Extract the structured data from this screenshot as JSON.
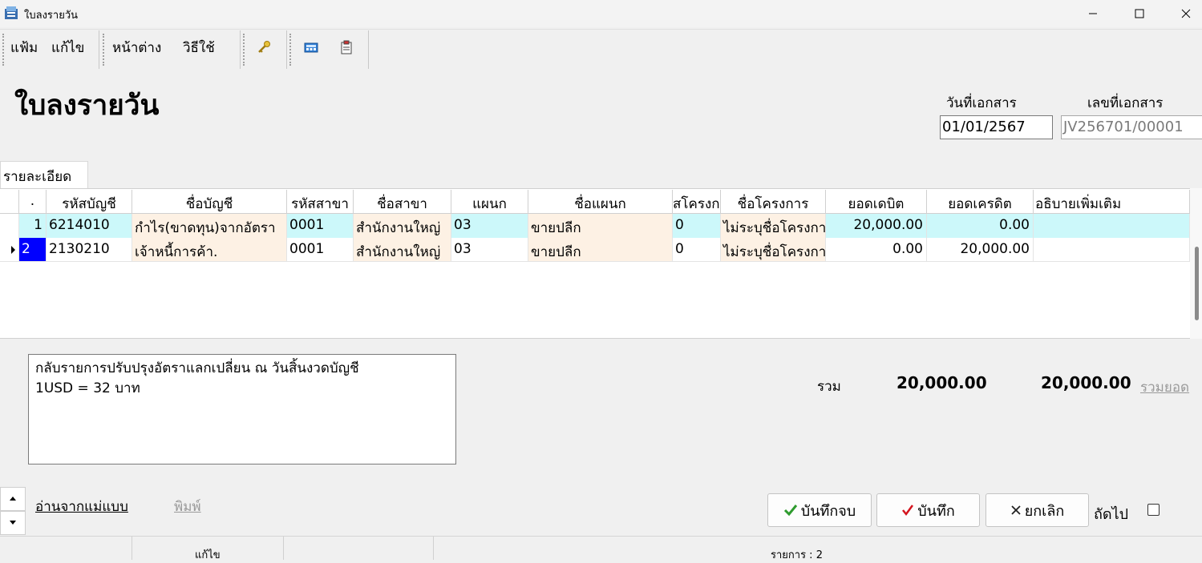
{
  "window": {
    "title": "ใบลงรายวัน"
  },
  "menu": {
    "file": "แฟ้ม",
    "edit": "แก้ไข",
    "window": "หน้าต่าง",
    "help": "วิธีใช้"
  },
  "page": {
    "title": "ใบลงรายวัน"
  },
  "doc": {
    "date_label": "วันที่เอกสาร",
    "date_value": "01/01/2567",
    "number_label": "เลขที่เอกสาร",
    "number_value": "JV256701/00001"
  },
  "tabs": {
    "detail": "รายละเอียด"
  },
  "grid": {
    "headers": {
      "seq": ".",
      "account_code": "รหัสบัญชี",
      "account_name": "ชื่อบัญชี",
      "branch_code": "รหัสสาขา",
      "branch_name": "ชื่อสาขา",
      "dept": "แผนก",
      "dept_name": "ชื่อแผนก",
      "project_code": "สโครงก",
      "project_name": "ชื่อโครงการ",
      "debit": "ยอดเดบิต",
      "credit": "ยอดเครดิต",
      "note": "อธิบายเพิ่มเติม"
    },
    "rows": [
      {
        "seq": "1",
        "account_code": "6214010",
        "account_name": "กำไร(ขาดทุน)จากอัตรา",
        "branch_code": "0001",
        "branch_name": "สำนักงานใหญ่",
        "dept": "03",
        "dept_name": "ขายปลีก",
        "project_code": "0",
        "project_name": "ไม่ระบุชื่อโครงการ",
        "debit": "20,000.00",
        "credit": "0.00",
        "note": ""
      },
      {
        "seq": "2",
        "account_code": "2130210",
        "account_name": "เจ้าหนี้การค้า.",
        "branch_code": "0001",
        "branch_name": "สำนักงานใหญ่",
        "dept": "03",
        "dept_name": "ขายปลีก",
        "project_code": "0",
        "project_name": "ไม่ระบุชื่อโครงการ",
        "debit": "0.00",
        "credit": "20,000.00",
        "note": ""
      }
    ]
  },
  "remark": "กลับรายการปรับปรุงอัตราแลกเปลี่ยน ณ วันสิ้นงวดบัญชี\n1USD = 32 บาท",
  "totals": {
    "label": "รวม",
    "debit": "20,000.00",
    "credit": "20,000.00",
    "link": "รวมยอด"
  },
  "links": {
    "template": "อ่านจากแม่แบบ",
    "print": "พิมพ์"
  },
  "buttons": {
    "save_close": "บันทึกจบ",
    "save": "บันทึก",
    "cancel": "ยกเลิก",
    "next": "ถัดไป"
  },
  "status": {
    "mode": "แก้ไข",
    "items": "รายการ : 2"
  },
  "colors": {
    "selected_row": "#ccf8fa",
    "lookup_cell": "#fdf1e4",
    "row_indicator": "#0000ff",
    "save_green": "#2e9b2e",
    "save_red": "#d4141e"
  }
}
